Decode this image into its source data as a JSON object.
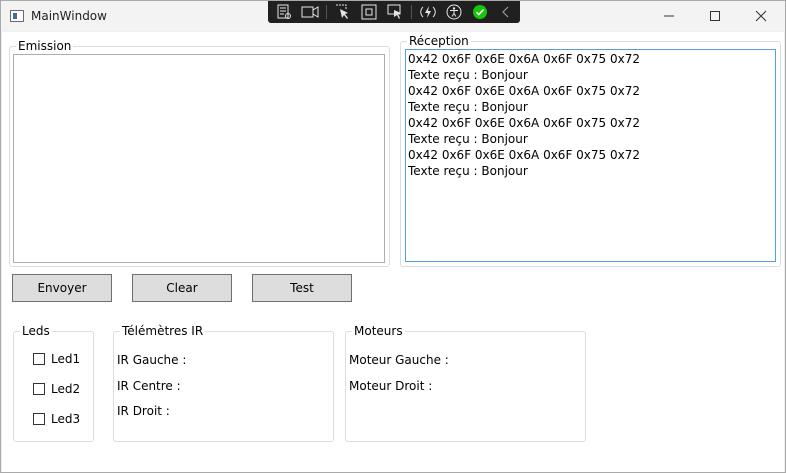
{
  "window": {
    "title": "MainWindow"
  },
  "debug_toolbar": {
    "icons": [
      "live-visual-tree-icon",
      "record-icon",
      "select-element-icon",
      "display-layout-adorners-icon",
      "track-focus-icon",
      "hot-reload-icon",
      "accessibility-icon",
      "binding-ok-icon",
      "collapse-icon"
    ]
  },
  "emission": {
    "label": "Emission",
    "text": ""
  },
  "reception": {
    "label": "Réception",
    "lines": [
      "0x42 0x6F 0x6E 0x6A 0x6F 0x75 0x72",
      "Texte reçu : Bonjour",
      "0x42 0x6F 0x6E 0x6A 0x6F 0x75 0x72",
      "Texte reçu : Bonjour",
      "0x42 0x6F 0x6E 0x6A 0x6F 0x75 0x72",
      "Texte reçu : Bonjour",
      "0x42 0x6F 0x6E 0x6A 0x6F 0x75 0x72",
      "Texte reçu : Bonjour"
    ]
  },
  "buttons": {
    "send": "Envoyer",
    "clear": "Clear",
    "test": "Test"
  },
  "leds": {
    "label": "Leds",
    "items": [
      {
        "label": "Led1",
        "checked": false
      },
      {
        "label": "Led2",
        "checked": false
      },
      {
        "label": "Led3",
        "checked": false
      }
    ]
  },
  "telemetres": {
    "label": "Télémètres IR",
    "gauche": "IR Gauche :",
    "centre": "IR Centre :",
    "droit": "IR Droit :"
  },
  "moteurs": {
    "label": "Moteurs",
    "gauche": "Moteur Gauche :",
    "droit": "Moteur Droit :"
  },
  "colors": {
    "accent_focus": "#569de5",
    "binding_ok": "#16c60c",
    "toolbar_bg": "#202020"
  }
}
